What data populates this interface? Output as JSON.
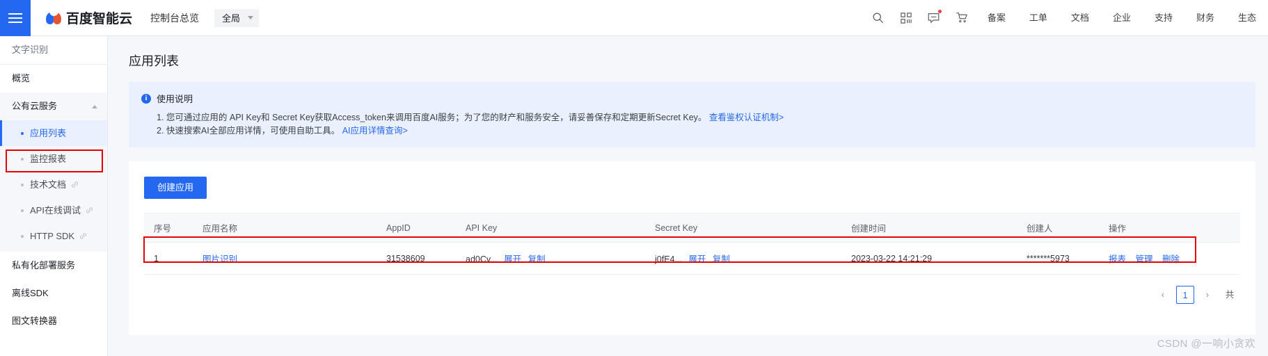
{
  "header": {
    "menu_icon": "hamburger-icon",
    "brand": "百度智能云",
    "console_link": "控制台总览",
    "scope": "全局",
    "icons": [
      {
        "name": "search-icon"
      },
      {
        "name": "apps-grid-icon"
      },
      {
        "name": "message-icon",
        "badge": true
      },
      {
        "name": "cart-icon"
      }
    ],
    "links": [
      "备案",
      "工单",
      "文档",
      "企业",
      "支持",
      "财务",
      "生态"
    ]
  },
  "sidebar": {
    "title": "文字识别",
    "overview": "概览",
    "group": {
      "label": "公有云服务",
      "items": [
        {
          "label": "应用列表",
          "external": false,
          "active": true
        },
        {
          "label": "监控报表",
          "external": false,
          "active": false
        },
        {
          "label": "技术文档",
          "external": true,
          "active": false
        },
        {
          "label": "API在线调试",
          "external": true,
          "active": false
        },
        {
          "label": "HTTP SDK",
          "external": true,
          "active": false
        }
      ]
    },
    "plain_items": [
      "私有化部署服务",
      "离线SDK",
      "图文转换器"
    ]
  },
  "main": {
    "page_title": "应用列表",
    "notice": {
      "title": "使用说明",
      "line1_prefix": "1. 您可通过应用的 API Key和 Secret Key获取Access_token来调用百度AI服务；为了您的财产和服务安全，请妥善保存和定期更新Secret Key。",
      "line1_link": "查看鉴权认证机制>",
      "line2_prefix": "2. 快速搜索AI全部应用详情，可使用自助工具。",
      "line2_link": "AI应用详情查询>"
    },
    "create_button": "创建应用",
    "table": {
      "columns": [
        "序号",
        "应用名称",
        "AppID",
        "API Key",
        "Secret Key",
        "创建时间",
        "创建人",
        "操作"
      ],
      "rows": [
        {
          "index": "1",
          "name": "图片识别",
          "appid": "31538609",
          "api_key": "ad0Cv...",
          "api_key_expand": "展开",
          "api_key_copy": "复制",
          "secret_key": "j0fE4...",
          "secret_key_expand": "展开",
          "secret_key_copy": "复制",
          "created_at": "2023-03-22 14:21:29",
          "creator": "*******5973",
          "ops": [
            "报表",
            "管理",
            "删除"
          ]
        }
      ]
    },
    "pagination": {
      "prev": "‹",
      "current": "1",
      "next": "›",
      "total": "共"
    }
  },
  "watermark": "CSDN @一响小贪欢",
  "colors": {
    "accent": "#2468f2",
    "notice_bg": "#eaf0fe",
    "annotation": "#e30000",
    "page_bg": "#f5f7fa"
  }
}
